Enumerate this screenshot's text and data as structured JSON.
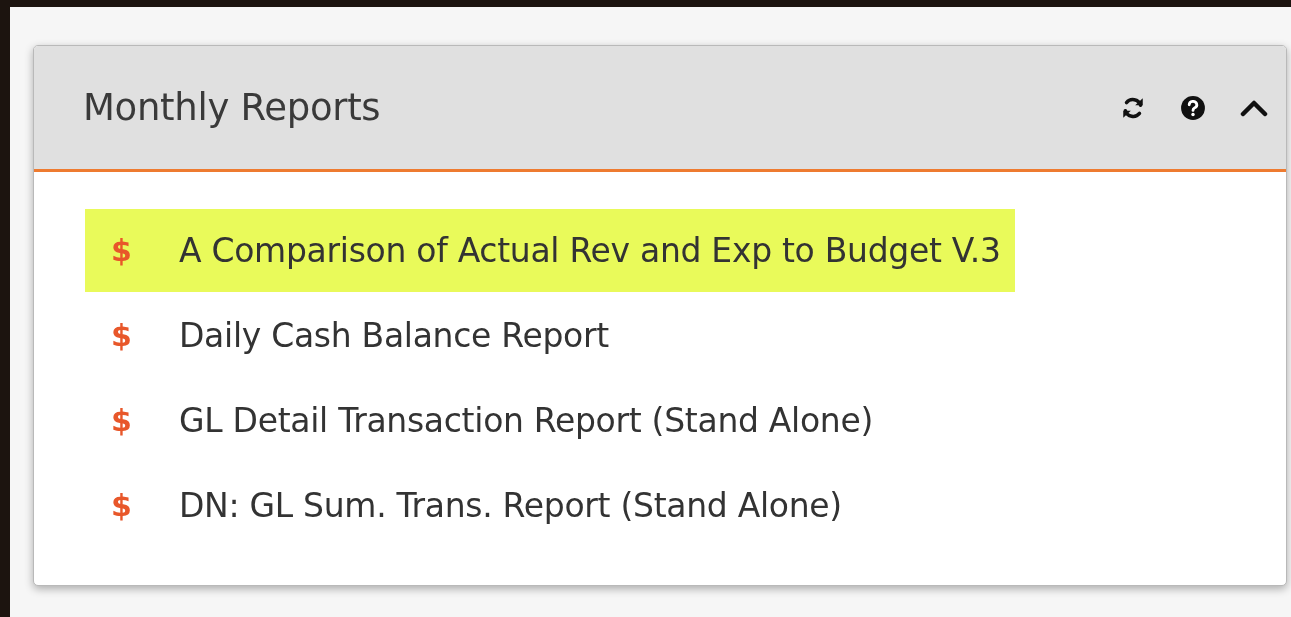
{
  "panel": {
    "title": "Monthly Reports",
    "expanded": true,
    "items": [
      {
        "icon": "$",
        "label": "A Comparison of Actual Rev and Exp to Budget V.3",
        "highlighted": true
      },
      {
        "icon": "$",
        "label": "Daily Cash Balance Report",
        "highlighted": false
      },
      {
        "icon": "$",
        "label": "GL Detail Transaction Report (Stand Alone)",
        "highlighted": false
      },
      {
        "icon": "$",
        "label": "DN: GL Sum. Trans. Report (Stand Alone)",
        "highlighted": false
      }
    ]
  }
}
